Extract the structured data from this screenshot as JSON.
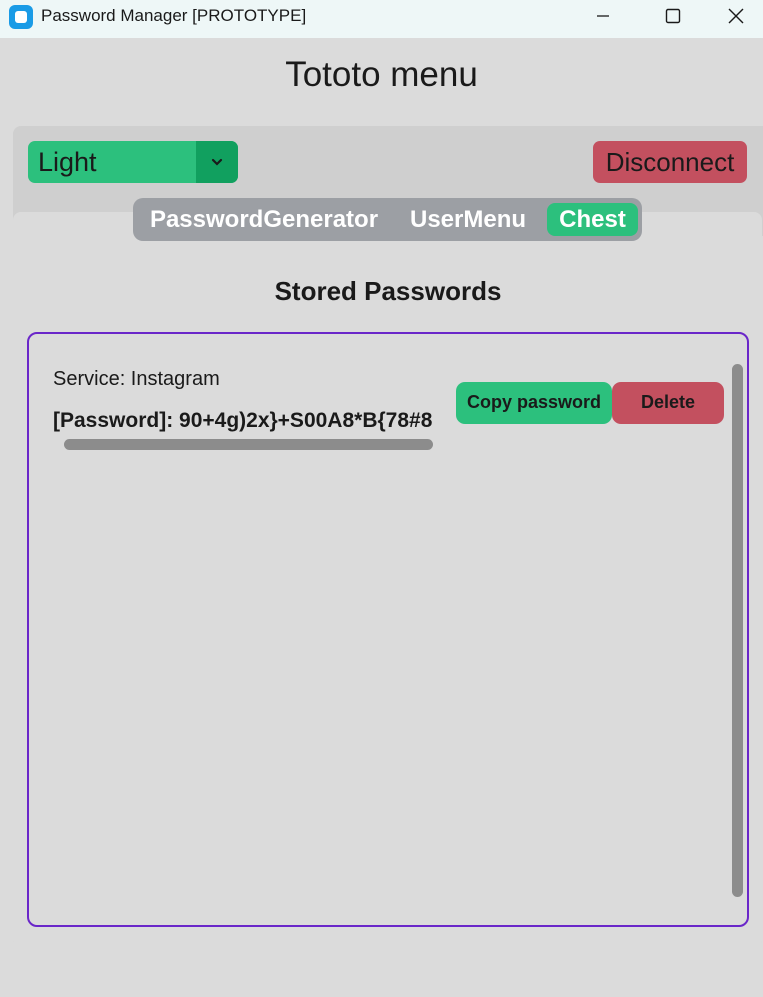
{
  "window": {
    "title": "Password Manager [PROTOTYPE]",
    "icon": "app-icon",
    "controls": [
      "minimize-icon",
      "maximize-icon",
      "close-icon"
    ]
  },
  "header": {
    "title": "Tototo menu"
  },
  "toolbar": {
    "theme_value": "Light",
    "disconnect_label": "Disconnect"
  },
  "tabs": [
    {
      "label": "PasswordGenerator",
      "active": false
    },
    {
      "label": "UserMenu",
      "active": false
    },
    {
      "label": "Chest",
      "active": true
    }
  ],
  "chest": {
    "section_title": "Stored Passwords",
    "entries": [
      {
        "service": "Service: Instagram",
        "password": "[Password]: 90+4g)2x}+S00A8*B{78#8",
        "copy_label": "Copy password",
        "delete_label": "Delete"
      }
    ]
  },
  "colors": {
    "accent_green": "#2cc07d",
    "accent_green_dark": "#11a05f",
    "danger_red": "#c3505f",
    "frame_purple": "#6a26c9",
    "background": "#dbdbdb"
  }
}
